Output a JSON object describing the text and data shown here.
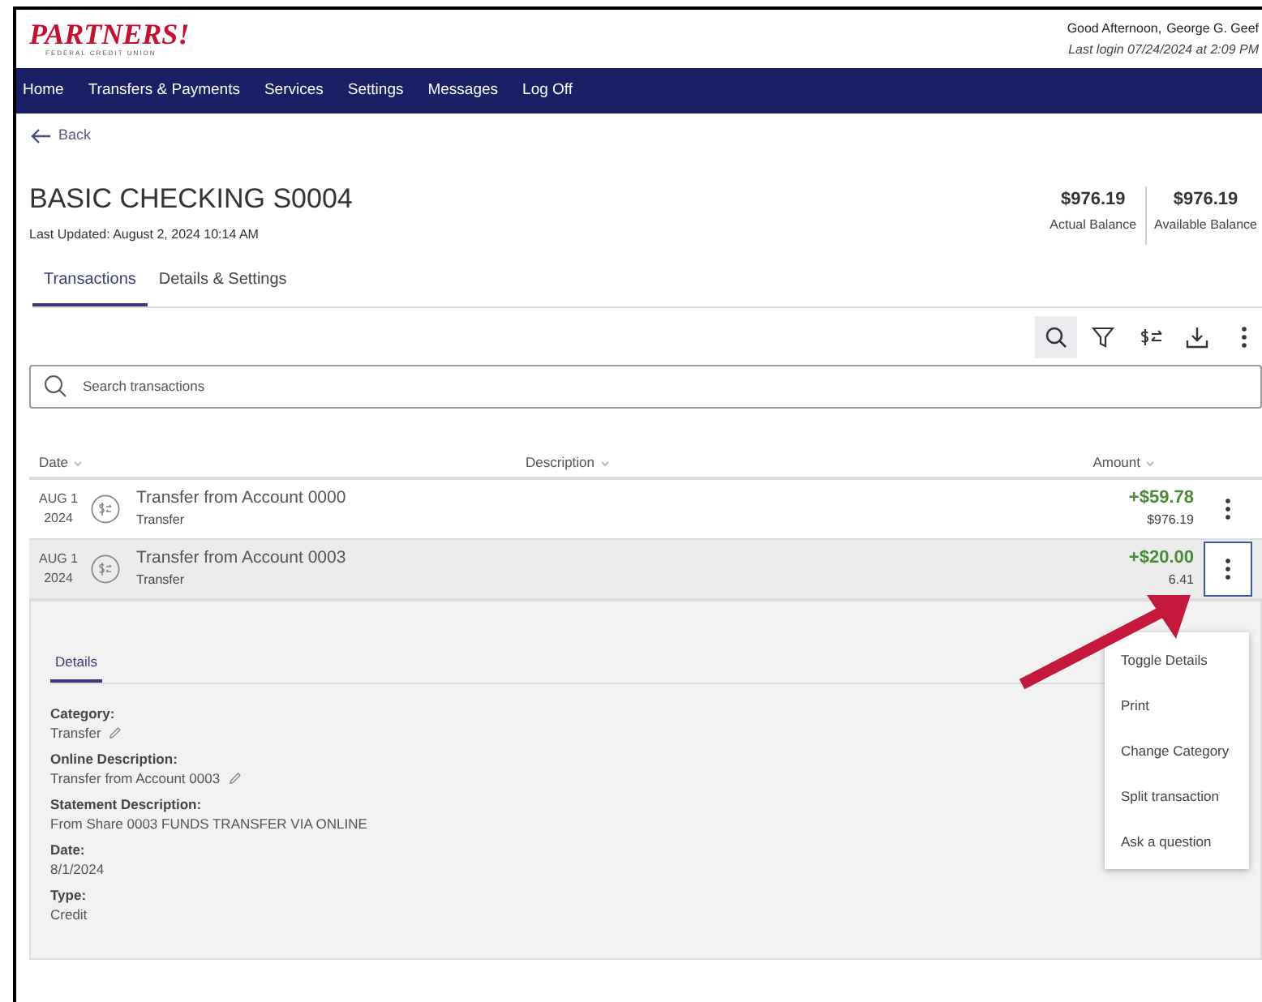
{
  "logo": {
    "name": "PARTNERS!",
    "tagline": "FEDERAL CREDIT UNION"
  },
  "greeting": {
    "salutation": "Good Afternoon,",
    "user": "George G. Geef",
    "last_login": "Last login 07/24/2024 at 2:09 PM"
  },
  "nav": [
    "Home",
    "Transfers & Payments",
    "Services",
    "Settings",
    "Messages",
    "Log Off"
  ],
  "back": "Back",
  "account": {
    "title": "BASIC CHECKING S0004",
    "updated": "Last Updated: August 2, 2024 10:14 AM"
  },
  "balances": [
    {
      "amount": "$976.19",
      "label": "Actual Balance"
    },
    {
      "amount": "$976.19",
      "label": "Available Balance"
    }
  ],
  "tabs": [
    {
      "label": "Transactions",
      "selected": true
    },
    {
      "label": "Details & Settings",
      "selected": false
    }
  ],
  "toolbar": [
    {
      "kind": "search",
      "selected": true
    },
    {
      "kind": "filter",
      "selected": false
    },
    {
      "kind": "transfer",
      "selected": false
    },
    {
      "kind": "download",
      "selected": false
    },
    {
      "kind": "more",
      "selected": false
    }
  ],
  "search": {
    "placeholder": "Search transactions"
  },
  "columns": [
    "Date",
    "Description",
    "Amount"
  ],
  "rows": [
    {
      "month": "AUG 1",
      "year": "2024",
      "description": "Transfer from Account 0000",
      "category": "Transfer",
      "amount": "+$59.78",
      "balance": "$976.19",
      "selected": false
    },
    {
      "month": "AUG 1",
      "year": "2024",
      "description": "Transfer from Account 0003",
      "category": "Transfer",
      "amount": "+$20.00",
      "balance": "6.41",
      "selected": true
    }
  ],
  "details": {
    "tab": "Details",
    "fields": [
      {
        "label": "Category:",
        "value": "Transfer",
        "editable": true
      },
      {
        "label": "Online Description:",
        "value": "Transfer from Account 0003",
        "editable": true
      },
      {
        "label": "Statement Description:",
        "value": "From Share 0003 FUNDS TRANSFER VIA ONLINE",
        "editable": false
      },
      {
        "label": "Date:",
        "value": "8/1/2024",
        "editable": false
      },
      {
        "label": "Type:",
        "value": "Credit",
        "editable": false
      }
    ]
  },
  "menu": [
    "Toggle Details",
    "Print",
    "Change Category",
    "Split transaction",
    "Ask a question"
  ]
}
